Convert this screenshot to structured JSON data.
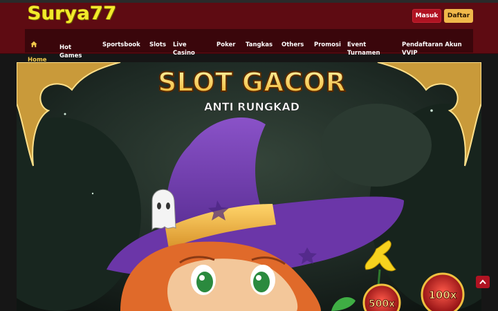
{
  "brand": {
    "logo_text": "Surya77"
  },
  "auth": {
    "login_label": "Masuk",
    "register_label": "Daftar"
  },
  "nav": {
    "items": [
      {
        "label": "Home",
        "icon": "home-icon",
        "active": true
      },
      {
        "label": "Hot\nGames"
      },
      {
        "label": "Sportsbook"
      },
      {
        "label": "Slots"
      },
      {
        "label": "Live\nCasino"
      },
      {
        "label": "Poker"
      },
      {
        "label": "Tangkas"
      },
      {
        "label": "Others"
      },
      {
        "label": "Promosi"
      },
      {
        "label": "Event\nTurnamen"
      },
      {
        "label": "Pendaftaran Akun\nVVIP"
      }
    ]
  },
  "banner": {
    "title": "SLOT GACOR",
    "subtitle": "ANTI RUNGKAD",
    "badge_left": "500x",
    "badge_right": "100x"
  },
  "colors": {
    "header_bg": "#5e0b12",
    "nav_bg": "#3a060b",
    "accent_yellow": "#f2ea2c",
    "button_red": "#b01322",
    "button_gold": "#f0b84a"
  },
  "scroll_top_icon": "chevron-up-icon"
}
